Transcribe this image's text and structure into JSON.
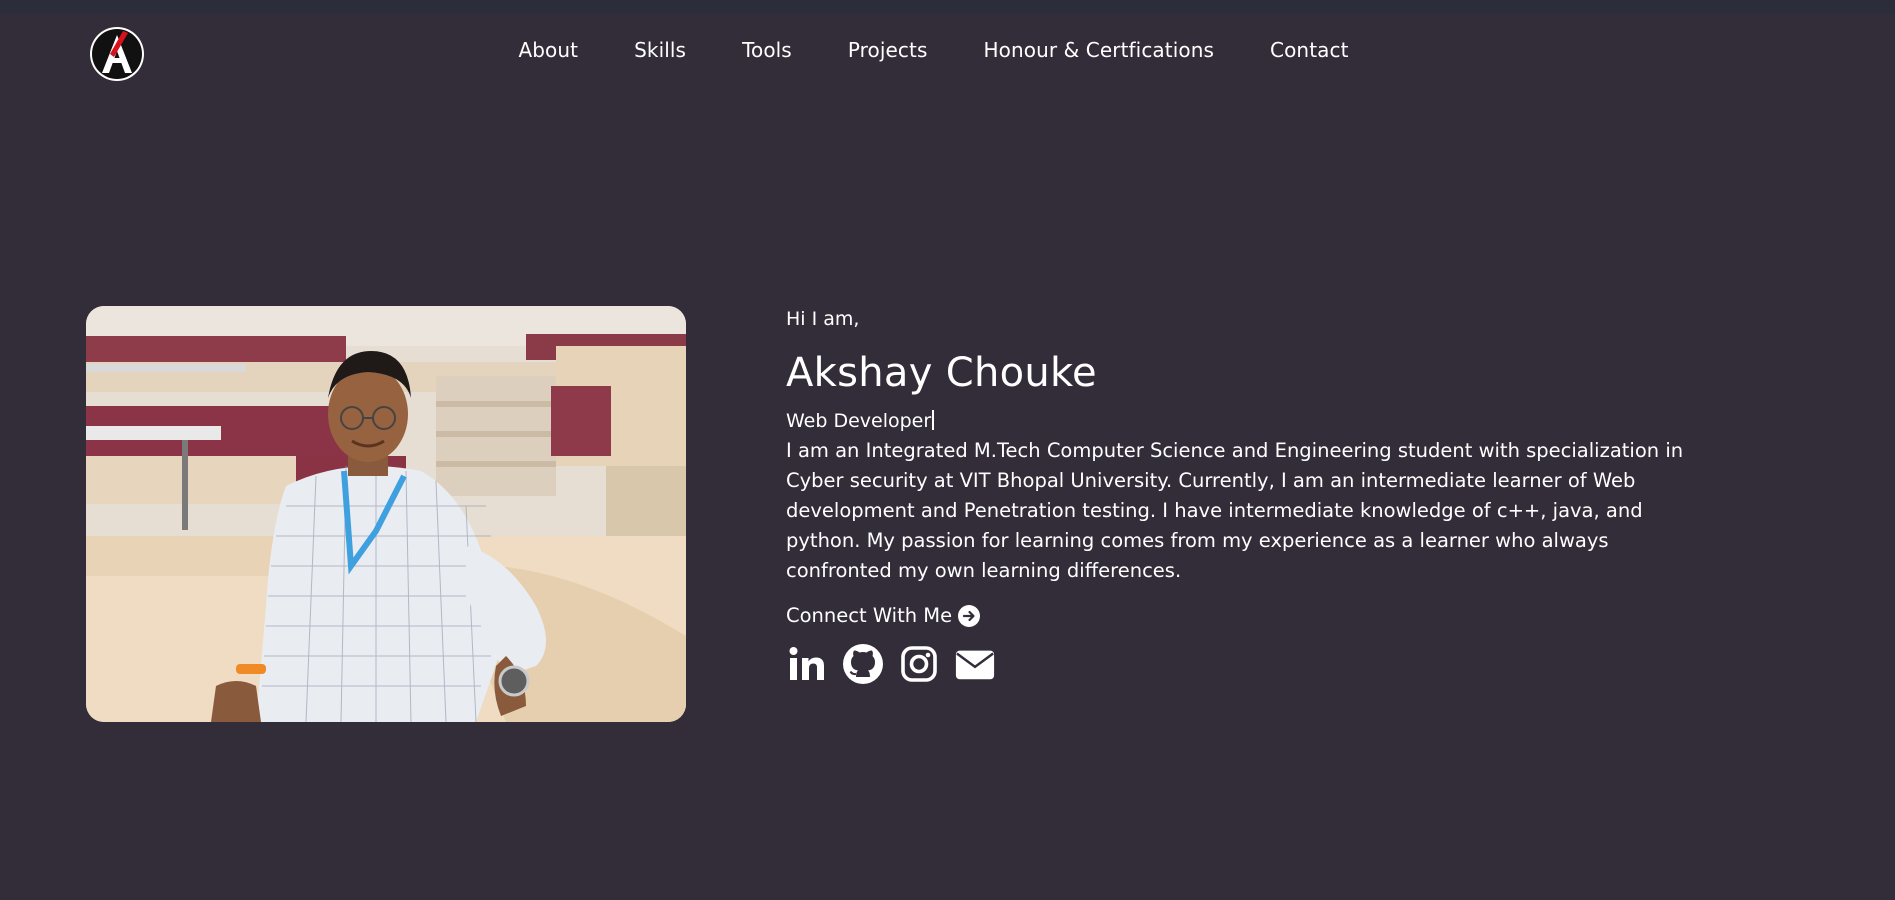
{
  "nav": {
    "items": [
      {
        "label": "About"
      },
      {
        "label": "Skills"
      },
      {
        "label": "Tools"
      },
      {
        "label": "Projects"
      },
      {
        "label": "Honour & Certfications"
      },
      {
        "label": "Contact"
      }
    ]
  },
  "hero": {
    "greeting": "Hi I am,",
    "name": "Akshay Chouke",
    "role": "Web Developer",
    "bio": "I am an Integrated M.Tech Computer Science and Engineering student with specialization in Cyber security at VIT Bhopal University. Currently, I am an intermediate learner of Web development and Penetration testing. I have intermediate knowledge of c++, java, and python. My passion for learning comes from my experience as a learner who always confronted my own learning differences.",
    "connect_label": "Connect With Me"
  },
  "socials": [
    {
      "icon": "linkedin-icon"
    },
    {
      "icon": "github-icon"
    },
    {
      "icon": "instagram-icon"
    },
    {
      "icon": "mail-icon"
    }
  ],
  "colors": {
    "background": "#332c39",
    "top_strip": "#2b2d3b",
    "text": "#ffffff",
    "logo_accent": "#d8121b"
  }
}
